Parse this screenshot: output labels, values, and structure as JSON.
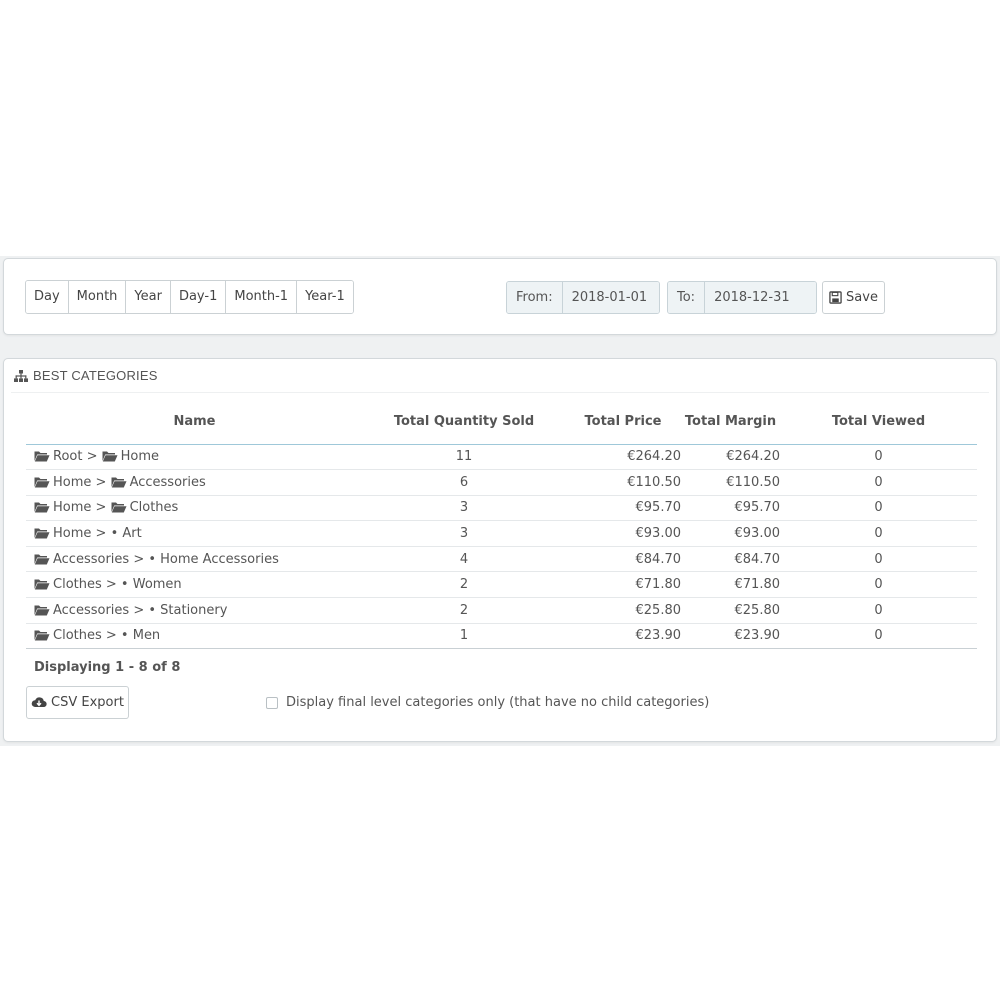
{
  "range_buttons": [
    "Day",
    "Month",
    "Year",
    "Day-1",
    "Month-1",
    "Year-1"
  ],
  "date_from": {
    "label": "From:",
    "value": "2018-01-01"
  },
  "date_to": {
    "label": "To:",
    "value": "2018-12-31"
  },
  "save_label": "Save",
  "panel": {
    "title": "BEST CATEGORIES",
    "icon": "sitemap-icon"
  },
  "table": {
    "headers": {
      "name": "Name",
      "qty": "Total Quantity Sold",
      "price": "Total Price",
      "margin": "Total Margin",
      "viewed": "Total Viewed"
    },
    "rows": [
      {
        "name_a": "Root >",
        "name_b": "Home",
        "b_icon": "folder",
        "qty": "11",
        "price": "€264.20",
        "margin": "€264.20",
        "viewed": "0"
      },
      {
        "name_a": "Home >",
        "name_b": "Accessories",
        "b_icon": "folder",
        "qty": "6",
        "price": "€110.50",
        "margin": "€110.50",
        "viewed": "0"
      },
      {
        "name_a": "Home >",
        "name_b": "Clothes",
        "b_icon": "folder",
        "qty": "3",
        "price": "€95.70",
        "margin": "€95.70",
        "viewed": "0"
      },
      {
        "name_a": "Home >",
        "name_b": "• Art",
        "b_icon": "none",
        "qty": "3",
        "price": "€93.00",
        "margin": "€93.00",
        "viewed": "0"
      },
      {
        "name_a": "Accessories >",
        "name_b": "• Home Accessories",
        "b_icon": "none",
        "qty": "4",
        "price": "€84.70",
        "margin": "€84.70",
        "viewed": "0"
      },
      {
        "name_a": "Clothes >",
        "name_b": "• Women",
        "b_icon": "none",
        "qty": "2",
        "price": "€71.80",
        "margin": "€71.80",
        "viewed": "0"
      },
      {
        "name_a": "Accessories >",
        "name_b": "• Stationery",
        "b_icon": "none",
        "qty": "2",
        "price": "€25.80",
        "margin": "€25.80",
        "viewed": "0"
      },
      {
        "name_a": "Clothes >",
        "name_b": "• Men",
        "b_icon": "none",
        "qty": "1",
        "price": "€23.90",
        "margin": "€23.90",
        "viewed": "0"
      }
    ]
  },
  "displaying": "Displaying 1 - 8 of 8",
  "csv_export_label": "CSV Export",
  "final_level_checkbox": {
    "label": "Display final level categories only (that have no child categories)",
    "checked": false
  }
}
